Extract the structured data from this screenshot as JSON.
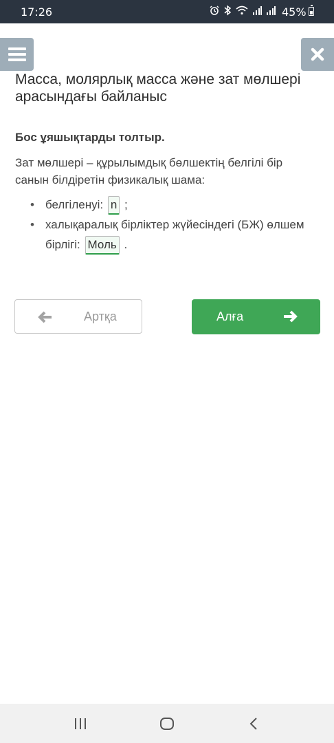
{
  "status_bar": {
    "time": "17:26",
    "battery_percent": "45%",
    "icons": [
      "alarm-icon",
      "bluetooth-icon",
      "wifi-icon",
      "signal-icon",
      "signal-icon",
      "battery-icon"
    ]
  },
  "header": {
    "menu_icon": "hamburger-icon",
    "close_icon": "close-icon",
    "title": "Масса, молярлық масса және зат мөлшері арасындағы байланыс"
  },
  "exercise": {
    "instruction": "Бос ұяшықтарды толтыр.",
    "intro": "Зат мөлшері – құрылымдық бөлшектің белгілі бір санын білдіретін физикалық шама:",
    "items": [
      {
        "prefix": "белгіленуі:",
        "answer": "n",
        "suffix": ";"
      },
      {
        "prefix": "халықаралық бірліктер жүйесіндегі (БЖ) өлшем бірлігі:",
        "answer": "Моль",
        "suffix": "."
      }
    ]
  },
  "navigation": {
    "back_label": "Артқа",
    "forward_label": "Алға"
  },
  "colors": {
    "status_bar": "#2b3440",
    "header_buttons": "#9eadb8",
    "forward_button": "#3fa756",
    "answer_underline": "#2e9e4a"
  }
}
